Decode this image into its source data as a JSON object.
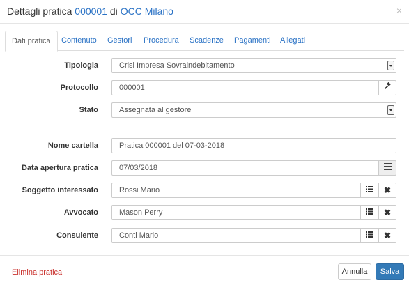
{
  "header": {
    "title_prefix": "Dettagli pratica",
    "practice_number": "000001",
    "title_middle": "di",
    "organization": "OCC Milano",
    "close_symbol": "×"
  },
  "tabs": [
    {
      "label": "Dati pratica",
      "active": true
    },
    {
      "label": "Contenuto"
    },
    {
      "label": "Gestori"
    },
    {
      "label": "Procedura"
    },
    {
      "label": "Scadenze"
    },
    {
      "label": "Pagamenti"
    },
    {
      "label": "Allegati"
    }
  ],
  "form": {
    "tipologia": {
      "label": "Tipologia",
      "value": "Crisi Impresa Sovraindebitamento"
    },
    "protocollo": {
      "label": "Protocollo",
      "value": "000001",
      "icon": "gavel-icon"
    },
    "stato": {
      "label": "Stato",
      "value": "Assegnata al gestore"
    },
    "nome_cartella": {
      "label": "Nome cartella",
      "value": "Pratica 000001 del 07-03-2018"
    },
    "data_apertura": {
      "label": "Data apertura pratica",
      "value": "07/03/2018",
      "icon": "calendar-icon"
    },
    "soggetto": {
      "label": "Soggetto interessato",
      "value": "Rossi Mario"
    },
    "avvocato": {
      "label": "Avvocato",
      "value": "Mason Perry"
    },
    "consulente": {
      "label": "Consulente",
      "value": "Conti Mario"
    }
  },
  "footer": {
    "delete_label": "Elimina pratica",
    "cancel_label": "Annulla",
    "save_label": "Salva"
  },
  "colors": {
    "link": "#2a72c5",
    "danger": "#c9302c",
    "primary": "#337ab7"
  }
}
